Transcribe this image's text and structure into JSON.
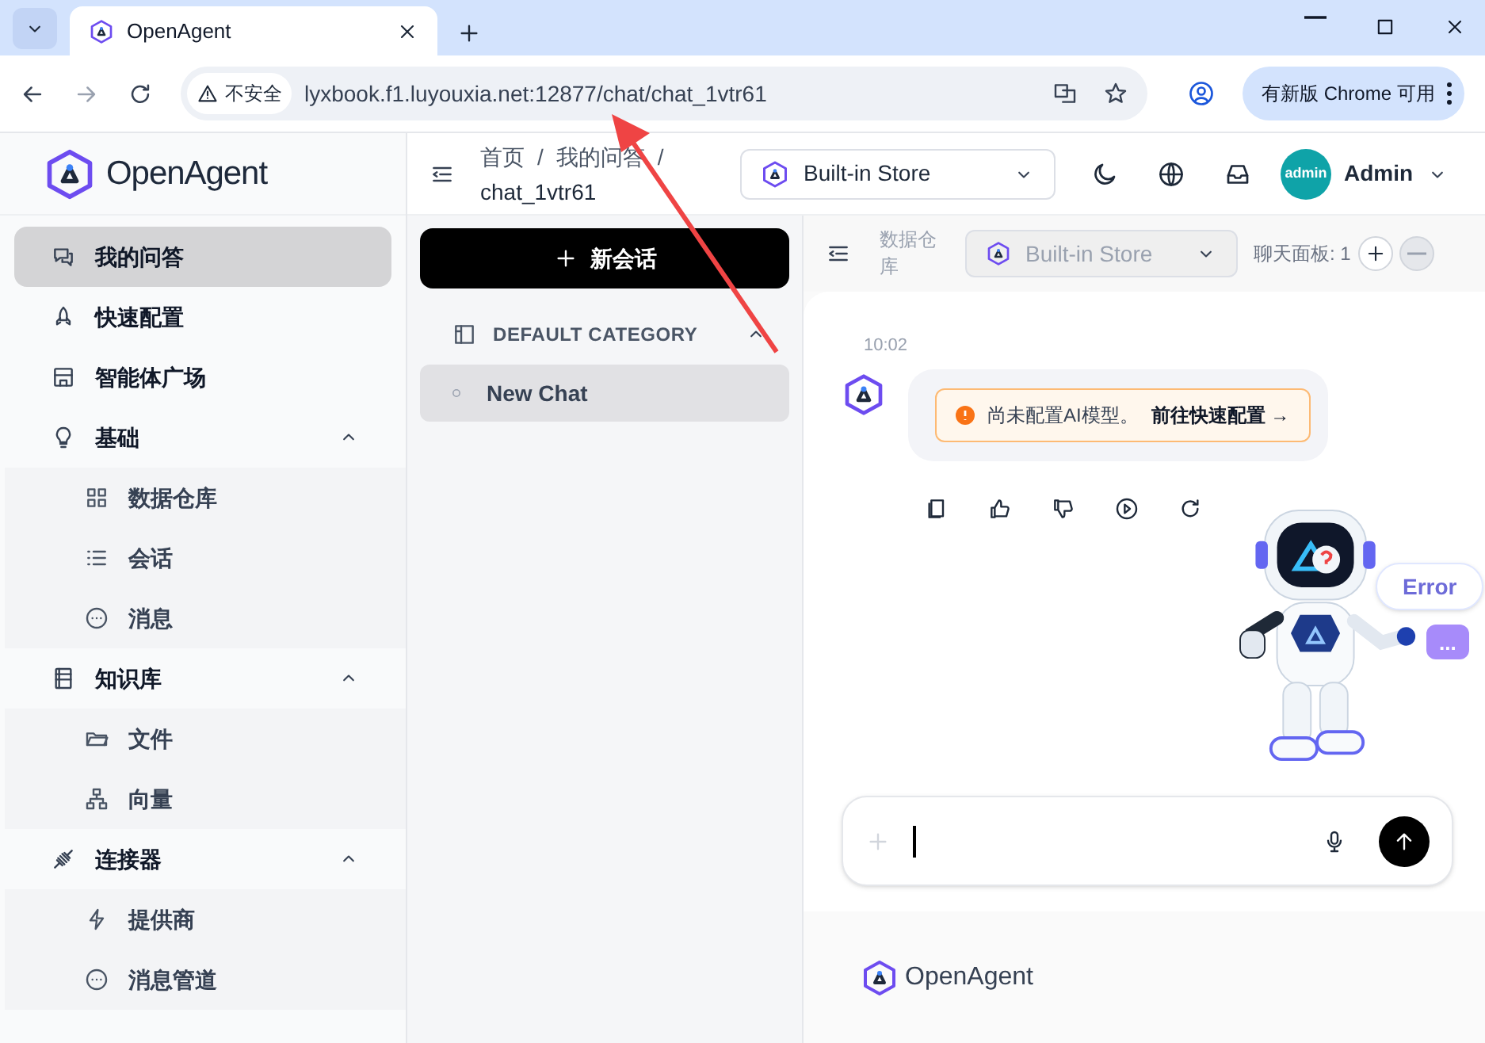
{
  "browser": {
    "tab_title": "OpenAgent",
    "security_label": "不安全",
    "url": "lyxbook.f1.luyouxia.net:12877/chat/chat_1vtr61",
    "update_button": "有新版 Chrome 可用"
  },
  "app": {
    "logo": "OpenAgent"
  },
  "sidebar": {
    "items": [
      {
        "label": "我的问答",
        "selected": true
      },
      {
        "label": "快速配置",
        "selected": false
      },
      {
        "label": "智能体广场",
        "selected": false
      },
      {
        "label": "基础",
        "selected": false,
        "expanded": true,
        "children": [
          {
            "label": "数据仓库",
            "selected": false
          },
          {
            "label": "会话",
            "selected": false
          },
          {
            "label": "消息",
            "selected": false
          }
        ]
      },
      {
        "label": "知识库",
        "selected": false,
        "expanded": true,
        "children": [
          {
            "label": "文件",
            "selected": false
          },
          {
            "label": "向量",
            "selected": false
          }
        ]
      },
      {
        "label": "连接器",
        "selected": false,
        "expanded": true,
        "children": [
          {
            "label": "提供商",
            "selected": false
          },
          {
            "label": "消息管道",
            "selected": false
          }
        ]
      }
    ]
  },
  "header": {
    "breadcrumb": [
      {
        "kind": "link",
        "text": "首页"
      },
      {
        "kind": "separator",
        "text": "/"
      },
      {
        "kind": "link",
        "text": "我的问答"
      },
      {
        "kind": "separator",
        "text": "/"
      },
      {
        "kind": "current",
        "text": "chat_1vtr61"
      }
    ],
    "store_select": "Built-in Store",
    "avatar_text": "admin",
    "user": "Admin"
  },
  "conversations": {
    "new_button": "新会话",
    "category": {
      "label": "DEFAULT CATEGORY",
      "expanded": true
    },
    "chats": [
      {
        "title": "New Chat",
        "selected": true
      }
    ]
  },
  "chat_toolbar": {
    "repo_label": "数据仓库",
    "store_select": "Built-in Store",
    "panel_label": "聊天面板: 1"
  },
  "messages": [
    {
      "time": "10:02",
      "notice": "尚未配置AI模型。",
      "link": "前往快速配置 →"
    }
  ],
  "robot": {
    "bubbles": [
      "Error",
      "..."
    ]
  },
  "footer": {
    "logo": "OpenAgent"
  }
}
